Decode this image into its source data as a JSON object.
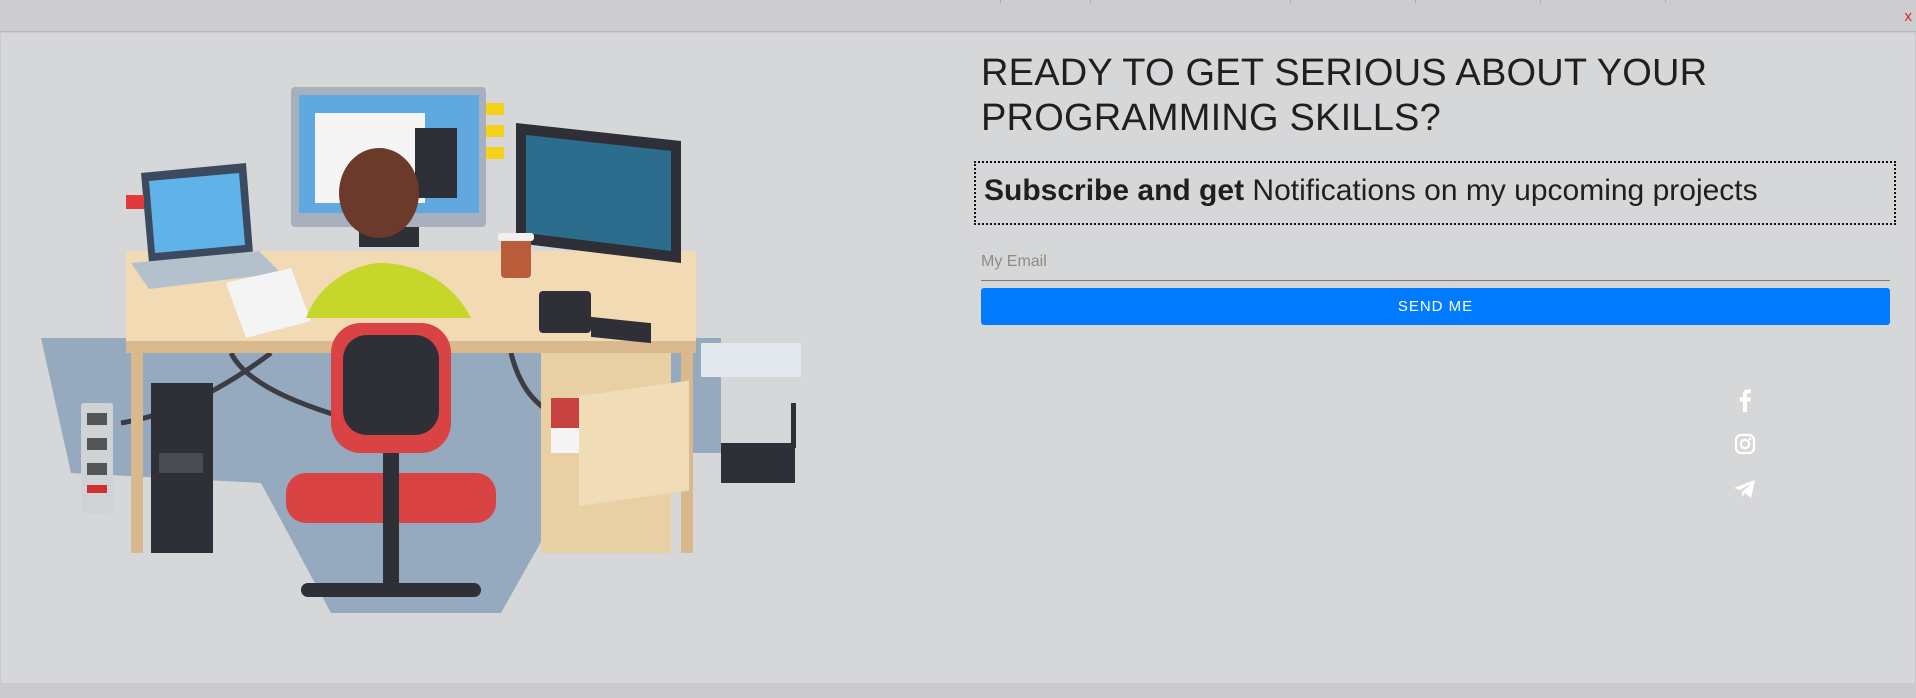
{
  "modal": {
    "close_label": "x",
    "headline": "READY TO GET SERIOUS ABOUT YOUR PROGRAMMING SKILLS?",
    "subscribe": {
      "bold": "Subscribe and get",
      "rest": " Notifications on my upcoming projects"
    },
    "email_placeholder": "My Email",
    "send_label": "SEND ME",
    "social": [
      {
        "icon": "facebook-icon"
      },
      {
        "icon": "instagram-icon"
      },
      {
        "icon": "telegram-icon"
      }
    ]
  },
  "colors": {
    "accent": "#007bff",
    "close": "#e0252b",
    "modal_bg": "#d6d7d9"
  }
}
